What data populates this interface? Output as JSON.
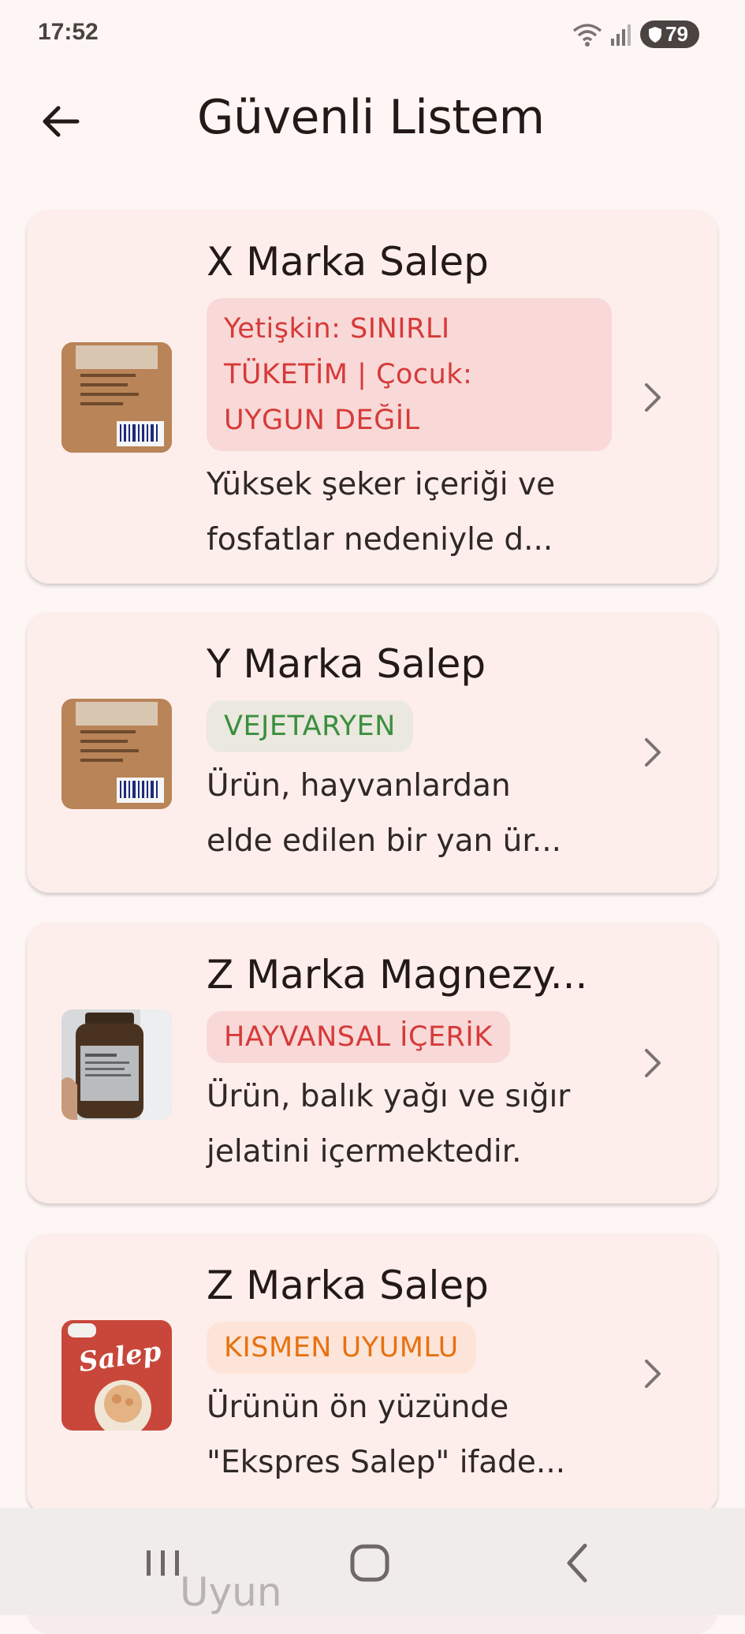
{
  "status_bar": {
    "time": "17:52",
    "battery": "79"
  },
  "app_bar": {
    "title": "Güvenli Listem"
  },
  "items": [
    {
      "title": "X Marka Salep",
      "badge": "Yetişkin: SINIRLI TÜKETİM | Çocuk: UYGUN DEĞİL",
      "badge_lines": [
        "Yetişkin: SINIRLI",
        "TÜKETİM | Çocuk:",
        "UYGUN DEĞİL"
      ],
      "badge_type": "red",
      "description_lines": [
        "Yüksek şeker içeriği ve",
        "fosfatlar nedeniyle d..."
      ],
      "thumb": "salep-back-package"
    },
    {
      "title": "Y Marka Salep",
      "badge": "VEJETARYEN",
      "badge_type": "green",
      "description_lines": [
        "Ürün, hayvanlardan",
        "elde edilen bir yan ür..."
      ],
      "thumb": "salep-back-package"
    },
    {
      "title": "Z Marka Magnezy...",
      "badge": "HAYVANSAL İÇERİK",
      "badge_type": "red",
      "description_lines": [
        "Ürün, balık yağı ve sığır",
        "jelatini içermektedir."
      ],
      "thumb": "supplement-bottle"
    },
    {
      "title": "Z Marka Salep",
      "badge": "KISMEN UYUMLU",
      "badge_type": "orange",
      "description_lines": [
        "Ürünün ön yüzünde",
        "\"Ekspres Salep\" ifade..."
      ],
      "thumb": "salep-front-package",
      "thumb_text": "Salep"
    }
  ],
  "peek_item": {
    "title": "Uyun"
  },
  "colors": {
    "background": "#fdf6f4",
    "card": "#fdeeec",
    "red": "#d63a3a",
    "green": "#3a8f3e",
    "orange": "#e67211"
  }
}
